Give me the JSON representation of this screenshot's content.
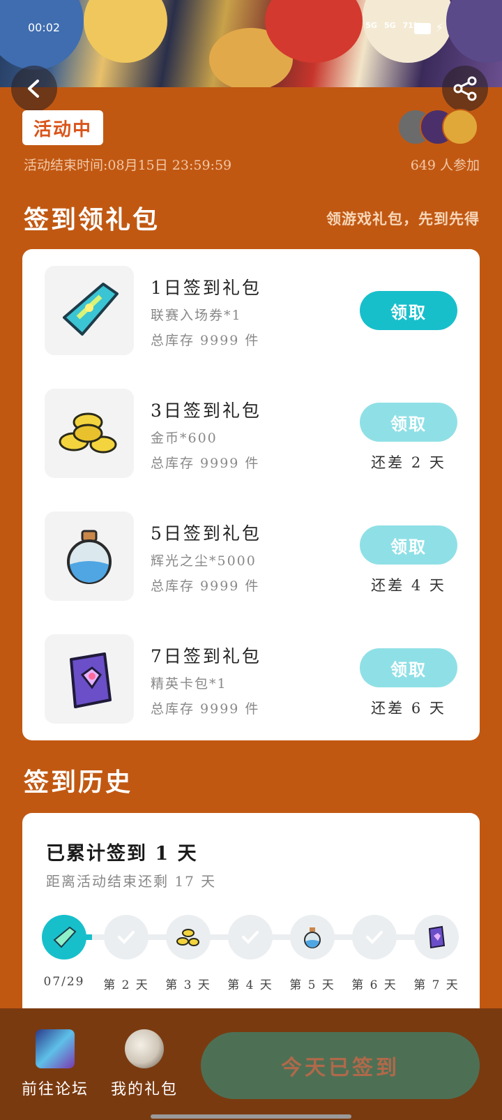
{
  "status_bar": {
    "time": "00:02",
    "net1": "5G",
    "net2": "5G",
    "battery": "71%"
  },
  "header": {
    "status_pill": "活动中",
    "end_time": "活动结束时间:08月15日 23:59:59",
    "participants": "649 人参加"
  },
  "signin": {
    "title": "签到领礼包",
    "subtitle": "领游戏礼包，先到先得",
    "gifts": [
      {
        "name": "1日签到礼包",
        "item": "联赛入场券*1",
        "stock": "总库存 9999 件",
        "button": "领取",
        "note": "",
        "icon": "ticket-icon"
      },
      {
        "name": "3日签到礼包",
        "item": "金币*600",
        "stock": "总库存 9999 件",
        "button": "领取",
        "note": "还差 2 天",
        "icon": "gold-coins-icon"
      },
      {
        "name": "5日签到礼包",
        "item": "辉光之尘*5000",
        "stock": "总库存 9999 件",
        "button": "领取",
        "note": "还差 4 天",
        "icon": "potion-bottle-icon"
      },
      {
        "name": "7日签到礼包",
        "item": "精英卡包*1",
        "stock": "总库存 9999 件",
        "button": "领取",
        "note": "还差 6 天",
        "icon": "card-pack-icon"
      }
    ]
  },
  "history": {
    "title": "签到历史",
    "total": "已累计签到 1 天",
    "remaining": "距离活动结束还剩 17 天",
    "progress_days_done": 1,
    "days": [
      "07/29",
      "第 2 天",
      "第 3 天",
      "第 4 天",
      "第 5 天",
      "第 6 天",
      "第 7 天"
    ]
  },
  "bottom": {
    "forum_label": "前往论坛",
    "gifts_label": "我的礼包",
    "signed_label": "今天已签到"
  },
  "colors": {
    "background": "#c15812",
    "accent": "#17bfcb",
    "accent_disabled": "#8fe0e6",
    "bottom_bar": "#7a3a10",
    "signed_button": "#4d7055"
  }
}
